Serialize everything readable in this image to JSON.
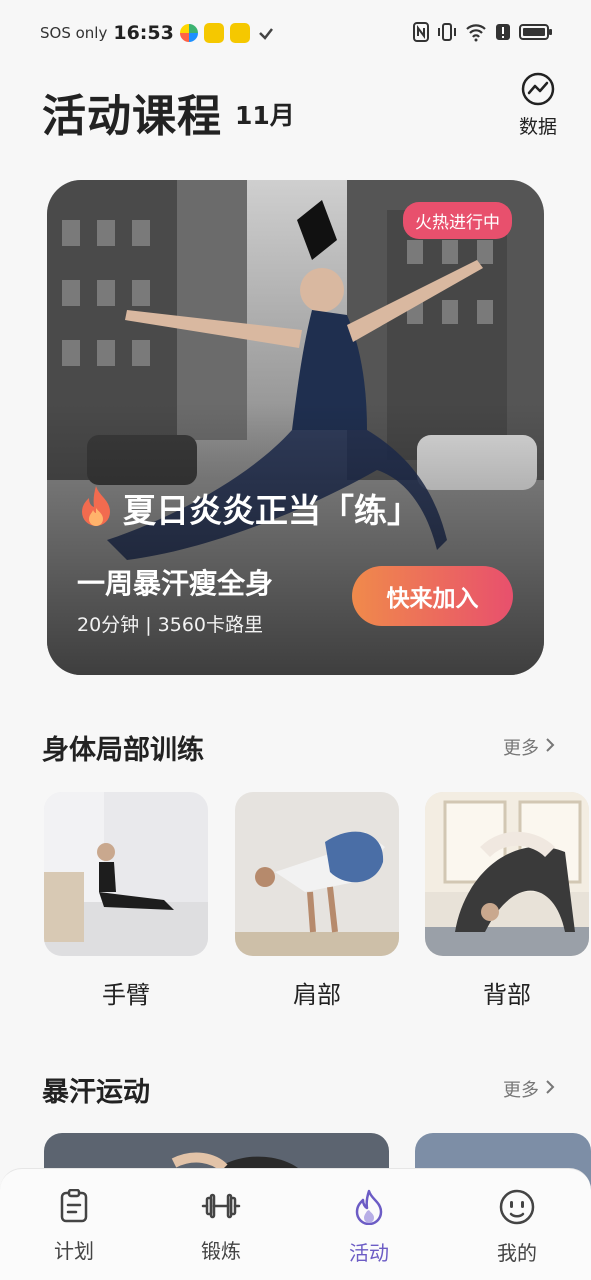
{
  "status_bar": {
    "carrier": "SOS only",
    "time": "16:53",
    "icons": [
      "nfc-icon",
      "vibrate-icon",
      "wifi-icon",
      "alert-icon",
      "battery-icon"
    ]
  },
  "header": {
    "title": "活动课程",
    "month": "11月",
    "data_label": "数据",
    "data_icon": "trend-chart-icon"
  },
  "hero": {
    "badge": "火热进行中",
    "title": "夏日炎炎正当「练」",
    "subtitle": "一周暴汗瘦全身",
    "meta": "20分钟 | 3560卡路里",
    "join_label": "快来加入",
    "accent": "#e8506d"
  },
  "body_parts": {
    "title": "身体局部训练",
    "more": "更多",
    "items": [
      {
        "label": "手臂"
      },
      {
        "label": "肩部"
      },
      {
        "label": "背部"
      }
    ]
  },
  "sweat": {
    "title": "暴汗运动",
    "more": "更多"
  },
  "tabbar": {
    "active_color": "#6c5cc5",
    "tabs": [
      {
        "label": "计划",
        "icon": "clipboard-icon"
      },
      {
        "label": "锻炼",
        "icon": "dumbbell-icon"
      },
      {
        "label": "活动",
        "icon": "flame-icon"
      },
      {
        "label": "我的",
        "icon": "smiley-icon"
      }
    ]
  }
}
